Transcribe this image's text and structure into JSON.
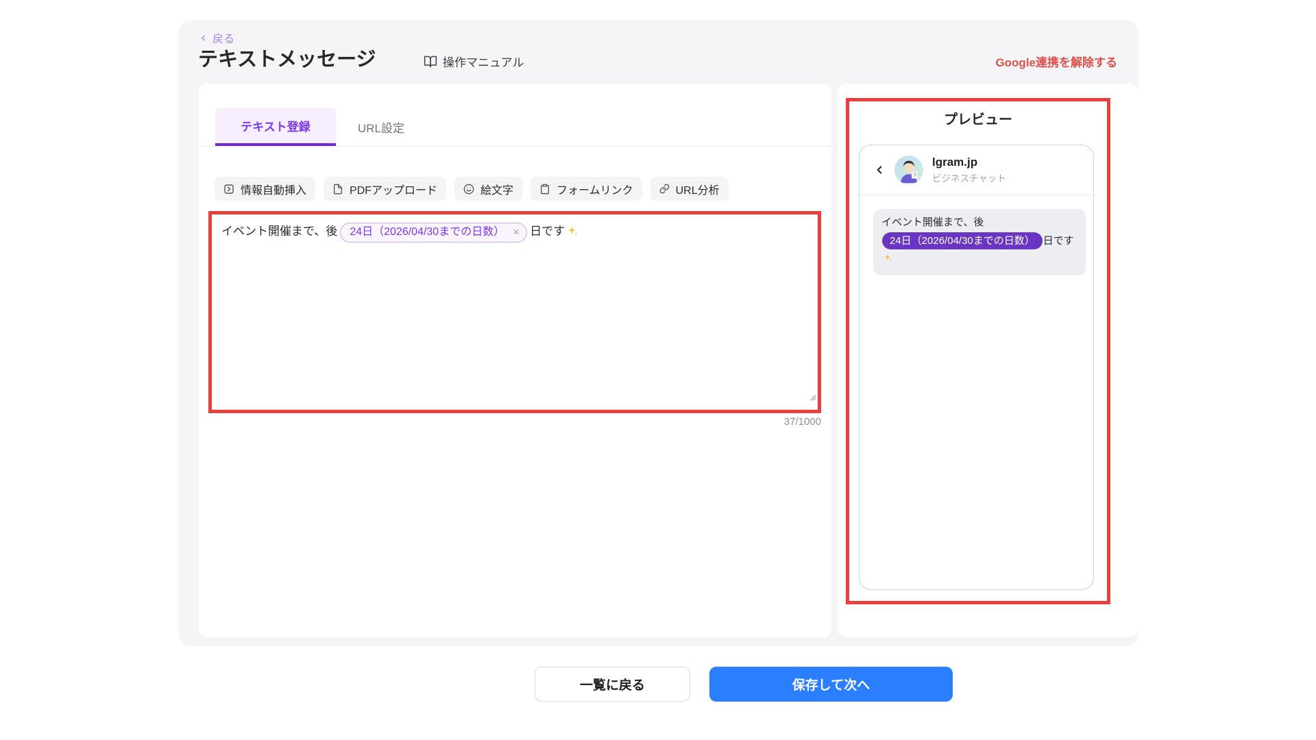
{
  "header": {
    "back_label": "戻る",
    "title": "テキストメッセージ",
    "manual_label": "操作マニュアル",
    "google_unlink_label": "Google連携を解除する"
  },
  "editor": {
    "tabs": [
      {
        "label": "テキスト登録",
        "active": true
      },
      {
        "label": "URL設定",
        "active": false
      }
    ],
    "toolbar": [
      {
        "icon": "auto-insert-icon",
        "label": "情報自動挿入"
      },
      {
        "icon": "pdf-upload-icon",
        "label": "PDFアップロード"
      },
      {
        "icon": "emoji-icon",
        "label": "絵文字"
      },
      {
        "icon": "form-link-icon",
        "label": "フォームリンク"
      },
      {
        "icon": "url-analysis-icon",
        "label": "URL分析"
      }
    ],
    "message": {
      "text_before": "イベント開催まで、後",
      "variable_tag": "24日（2026/04/30までの日数）",
      "close_glyph": "×",
      "text_after": "日です",
      "sparkle_emoji": "✨"
    },
    "char_count": "37/1000"
  },
  "preview": {
    "title": "プレビュー",
    "chat": {
      "name": "lgram.jp",
      "subtitle": "ビジネスチャット",
      "message": {
        "text_before": "イベント開催まで、後",
        "variable_tag": "24日（2026/04/30までの日数）",
        "text_after": "日です"
      }
    }
  },
  "footer": {
    "back_to_list_label": "一覧に戻る",
    "save_and_next_label": "保存して次へ"
  },
  "colors": {
    "accent_purple": "#7c3aed",
    "tab_underline_purple": "#6d28d9",
    "deep_purple_pill": "#6a35c2",
    "back_link_purple": "#a583ee",
    "annotation_red": "#e8403a",
    "google_unlink_red": "#e0504b",
    "primary_blue": "#2b7fff",
    "card_gray": "#f5f4f6",
    "bubble_gray": "#edeef1"
  }
}
